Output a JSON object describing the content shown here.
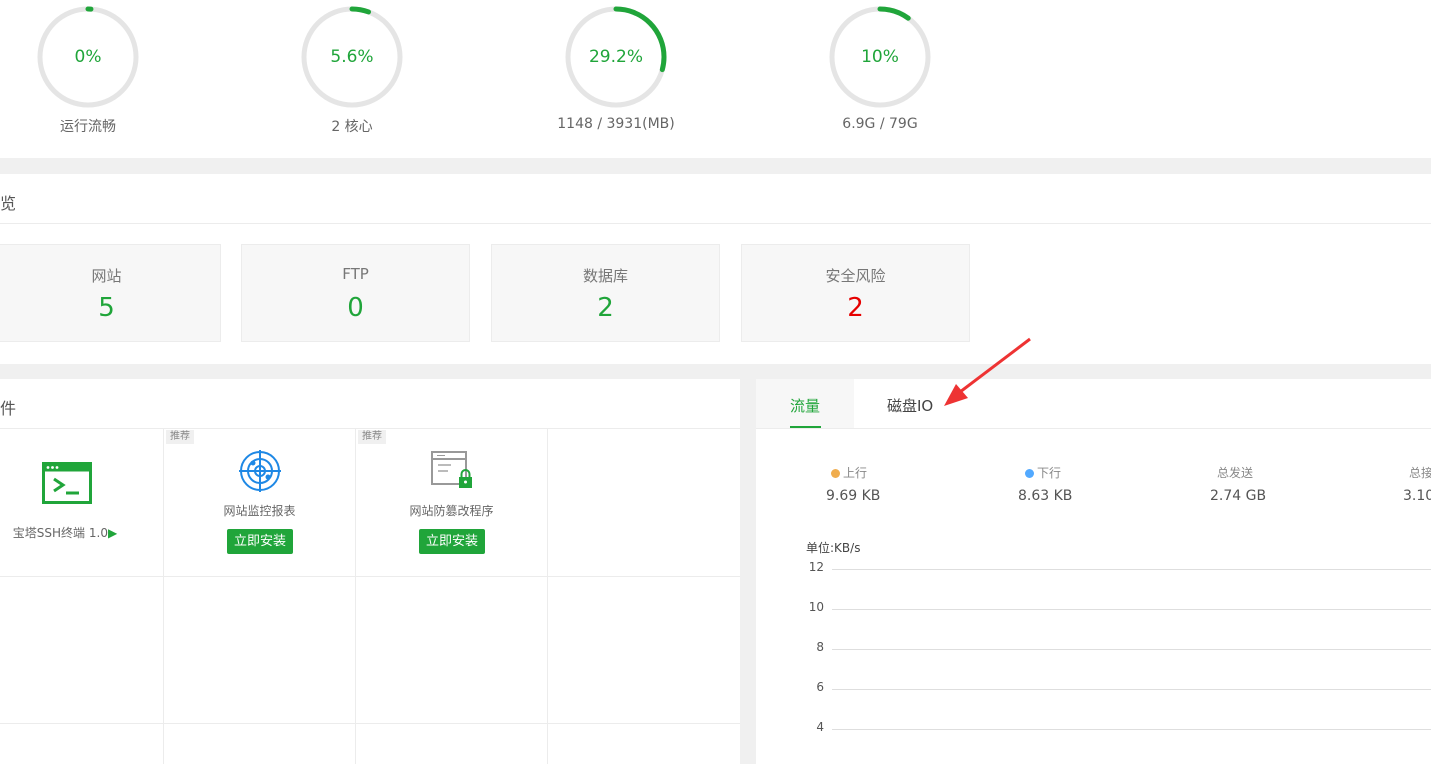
{
  "status": {
    "gauges": [
      {
        "id": "load",
        "value_text": "0%",
        "percent": 1,
        "caption": "运行流畅"
      },
      {
        "id": "cpu",
        "value_text": "5.6%",
        "percent": 5.6,
        "caption": "2 核心"
      },
      {
        "id": "memory",
        "value_text": "29.2%",
        "percent": 29.2,
        "caption": "1148 / 3931(MB)"
      },
      {
        "id": "disk",
        "value_text": "10%",
        "percent": 10,
        "caption": "6.9G / 79G"
      }
    ],
    "accent_color": "#20a53a",
    "track_color": "#e5e5e5"
  },
  "overview": {
    "title": "览",
    "cards": [
      {
        "label": "网站",
        "value": "5"
      },
      {
        "label": "FTP",
        "value": "0"
      },
      {
        "label": "数据库",
        "value": "2"
      },
      {
        "label": "安全风险",
        "value": "2",
        "status": "danger"
      }
    ]
  },
  "software": {
    "title": "件",
    "items": [
      {
        "name": "宝塔SSH终端 1.0",
        "icon": "terminal-icon",
        "play_glyph": "▶"
      },
      {
        "tag": "推荐",
        "name": "网站监控报表",
        "icon": "radar-icon",
        "button": "立即安装"
      },
      {
        "tag": "推荐",
        "name": "网站防篡改程序",
        "icon": "browser-lock-icon",
        "button": "立即安装"
      }
    ]
  },
  "traffic": {
    "tabs": [
      {
        "label": "流量",
        "active": true
      },
      {
        "label": "磁盘IO",
        "active": false
      }
    ],
    "stats": [
      {
        "label": "上行",
        "value": "9.69 KB",
        "dot_color": "#f0ad4e"
      },
      {
        "label": "下行",
        "value": "8.63 KB",
        "dot_color": "#52a9ff"
      },
      {
        "label": "总发送",
        "value": "2.74 GB"
      },
      {
        "label": "总接",
        "value": "3.10"
      }
    ],
    "unit_label": "单位:KB/s"
  },
  "chart_data": {
    "type": "line",
    "ylabel": "单位:KB/s",
    "y_ticks": [
      12,
      10,
      8,
      6,
      4
    ],
    "ylim": [
      0,
      12
    ],
    "grid": true,
    "series": []
  },
  "annotation": {
    "arrow_color": "#ee3333",
    "points_to": "磁盘IO"
  }
}
